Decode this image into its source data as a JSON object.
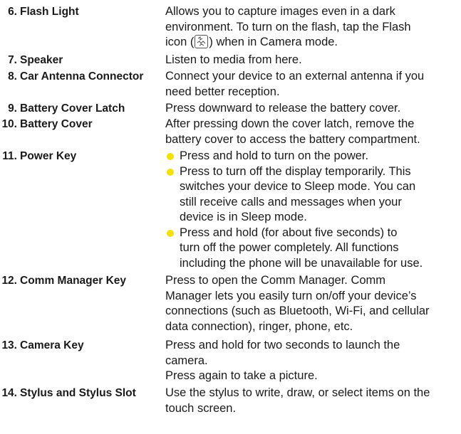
{
  "accent": "#f2e200",
  "items": [
    {
      "num": "6.",
      "label": "Flash Light",
      "lines": [
        "Allows you to capture images even in a dark",
        "environment. To turn on the flash, tap the Flash"
      ],
      "icon_before": "icon (",
      "icon_name": "flash-icon",
      "icon_after": ") when in Camera mode."
    },
    {
      "num": "7.",
      "label": "Speaker",
      "lines": [
        "Listen to media from here."
      ]
    },
    {
      "num": "8.",
      "label": "Car Antenna Connector",
      "lines": [
        "Connect your device to an external antenna if you",
        "need better reception."
      ]
    },
    {
      "num": "9.",
      "label": "Battery Cover Latch",
      "lines": [
        "Press downward to release the battery cover."
      ]
    },
    {
      "num": "10.",
      "label": "Battery Cover",
      "lines": [
        "After pressing down the cover latch, remove the",
        "battery cover to access the battery compartment."
      ]
    },
    {
      "num": "11.",
      "label": "Power Key",
      "bullets": [
        {
          "lines": [
            "Press and hold to turn on the power."
          ]
        },
        {
          "lines": [
            "Press to turn off the display temporarily. This",
            "switches your device to Sleep mode. You can",
            "still receive calls and messages when your",
            "device is in Sleep mode."
          ]
        },
        {
          "lines": [
            "Press and hold (for about five seconds) to",
            "turn off the power completely. All functions",
            "including the phone will be unavailable for use."
          ]
        }
      ]
    },
    {
      "num": "12.",
      "label": "Comm Manager Key",
      "lines": [
        "Press to open the Comm Manager. Comm",
        "Manager lets you easily turn on/off your device’s",
        "connections (such as Bluetooth, Wi-Fi, and cellular",
        "data connection), ringer, phone, etc."
      ]
    },
    {
      "num": "13.",
      "label": "Camera Key",
      "lines": [
        "Press and hold for two seconds to launch the",
        "camera.",
        "Press again to take a picture."
      ]
    },
    {
      "num": "14.",
      "label": "Stylus and Stylus Slot",
      "lines": [
        "Use the stylus to write, draw, or select items on the",
        "touch screen."
      ]
    }
  ]
}
